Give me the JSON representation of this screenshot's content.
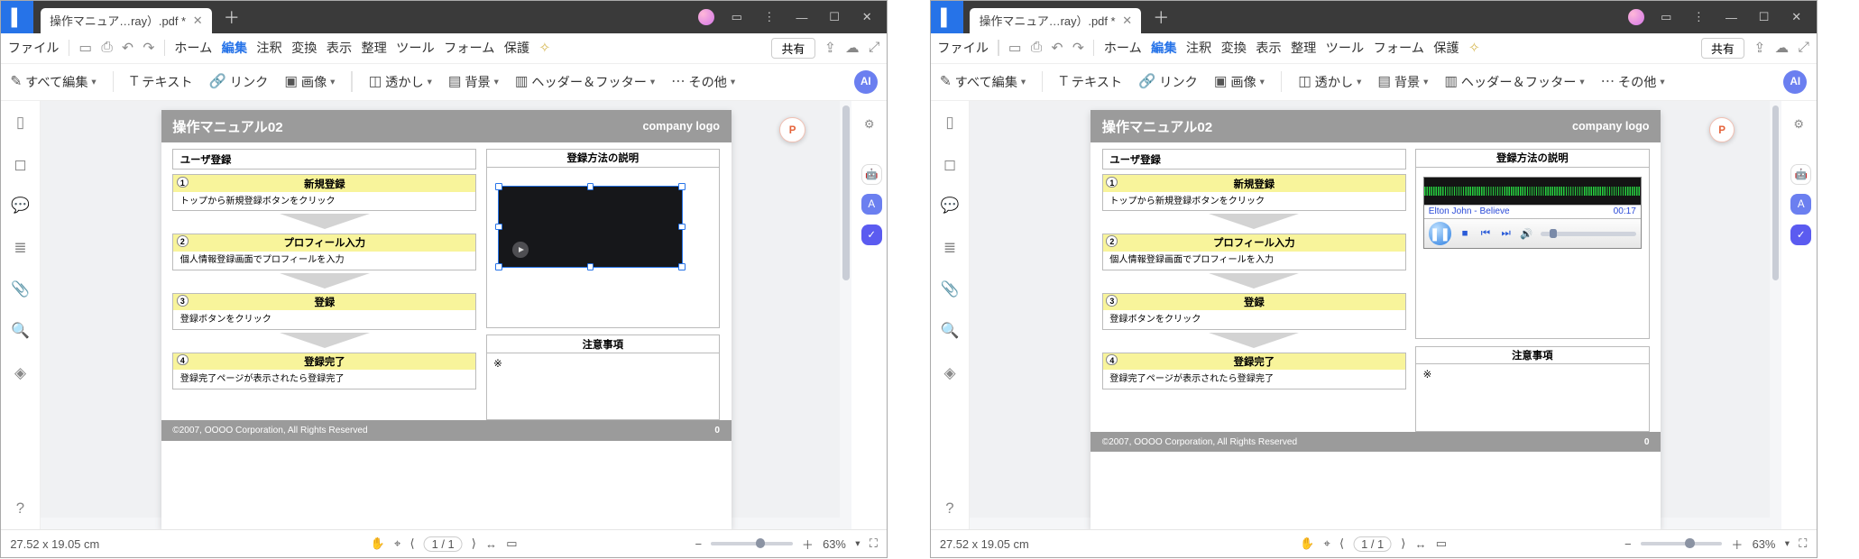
{
  "tab": {
    "title": "操作マニュア…ray）.pdf *"
  },
  "menu": {
    "file": "ファイル",
    "items": [
      "ホーム",
      "編集",
      "注釈",
      "変換",
      "表示",
      "整理",
      "ツール",
      "フォーム",
      "保護"
    ],
    "active_index": 1,
    "share": "共有"
  },
  "toolbar": {
    "edit_all": "すべて編集",
    "text": "テキスト",
    "link": "リンク",
    "image": "画像",
    "watermark": "透かし",
    "background": "背景",
    "header_footer": "ヘッダー＆フッター",
    "other": "その他",
    "ai": "AI"
  },
  "doc": {
    "title": "操作マニュアル02",
    "logo": "company logo",
    "section": "ユーザ登録",
    "steps": [
      {
        "num": "1",
        "title": "新規登録",
        "body": "トップから新規登録ボタンをクリック"
      },
      {
        "num": "2",
        "title": "プロフィール入力",
        "body": "個人情報登録画面でプロフィールを入力"
      },
      {
        "num": "3",
        "title": "登録",
        "body": "登録ボタンをクリック"
      },
      {
        "num": "4",
        "title": "登録完了",
        "body": "登録完了ページが表示されたら登録完了"
      }
    ],
    "right1_title": "登録方法の説明",
    "right2_title": "注意事項",
    "right2_body": "※",
    "footer": "©2007, OOOO Corporation, All Rights Reserved",
    "page_num": "0"
  },
  "player": {
    "track": "Elton John - Believe",
    "time": "00:17"
  },
  "status": {
    "dims": "27.52 x 19.05 cm",
    "page_current": "1",
    "page_total": "/ 1",
    "zoom": "63%"
  },
  "ppt_badge": "P"
}
